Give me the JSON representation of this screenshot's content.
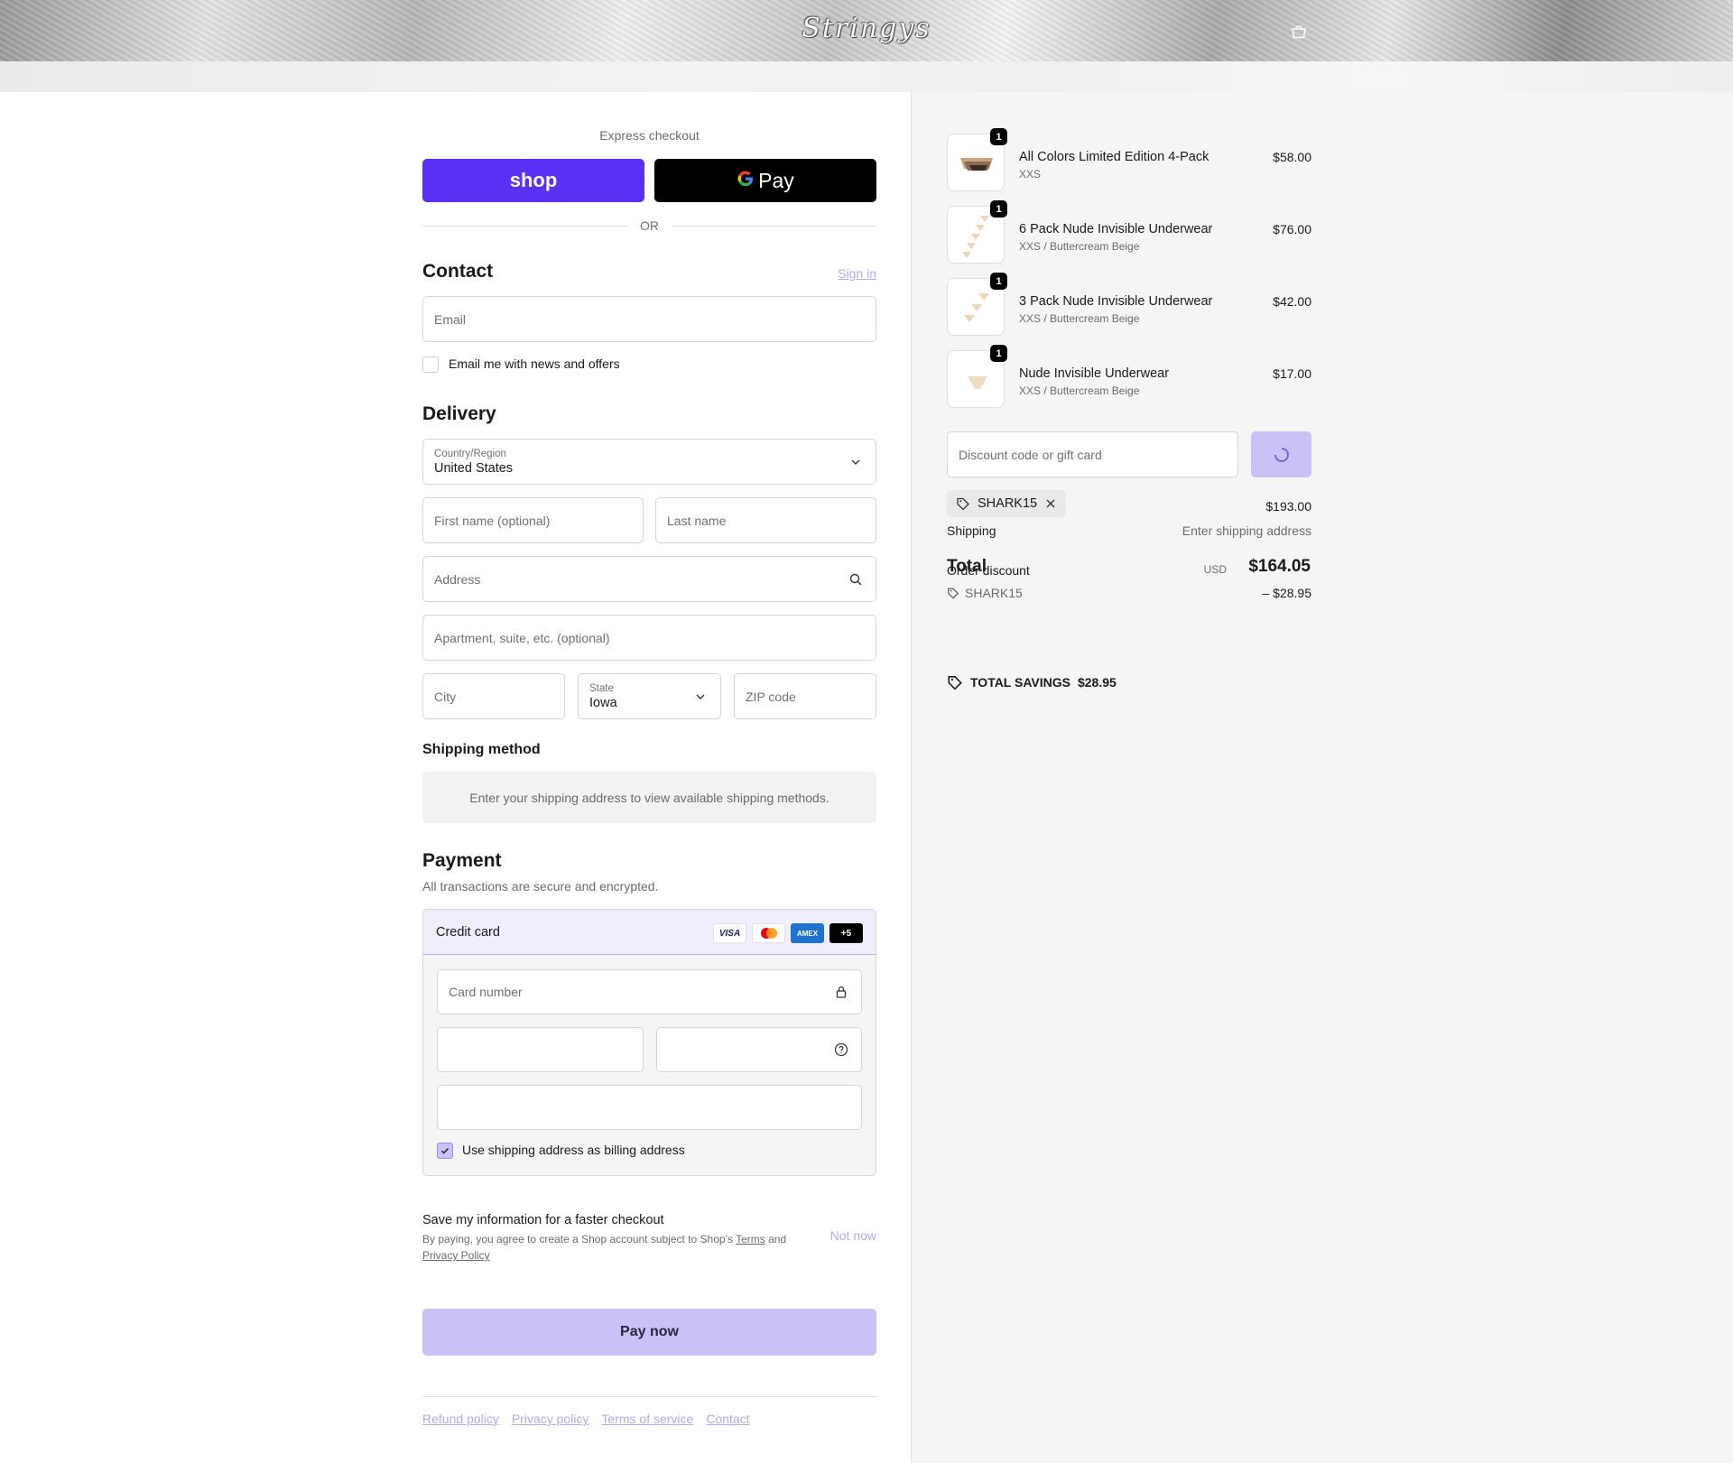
{
  "header": {
    "store_name": "Stringys",
    "cart_icon": "bag-icon"
  },
  "express": {
    "title": "Express checkout",
    "shop_label": "shop",
    "gpay_label": "Pay",
    "or_label": "OR"
  },
  "contact": {
    "title": "Contact",
    "sign_in": "Sign in",
    "email_placeholder": "Email",
    "newsletter_label": "Email me with news and offers",
    "newsletter_checked": false
  },
  "delivery": {
    "title": "Delivery",
    "country_label": "Country/Region",
    "country_value": "United States",
    "first_name_placeholder": "First name (optional)",
    "last_name_placeholder": "Last name",
    "address_placeholder": "Address",
    "apartment_placeholder": "Apartment, suite, etc. (optional)",
    "city_placeholder": "City",
    "state_label": "State",
    "state_value": "Iowa",
    "zip_placeholder": "ZIP code"
  },
  "shipping_method": {
    "title": "Shipping method",
    "message": "Enter your shipping address to view available shipping methods."
  },
  "payment": {
    "title": "Payment",
    "subtitle": "All transactions are secure and encrypted.",
    "method_label": "Credit card",
    "brands": [
      "VISA",
      "Mastercard",
      "AMEX",
      "+5"
    ],
    "card_number_placeholder": "Card number",
    "billing_same_label": "Use shipping address as billing address",
    "billing_same_checked": true
  },
  "save_info": {
    "title": "Save my information for a faster checkout",
    "text_before": "By paying, you agree to create a Shop account subject to Shop’s ",
    "terms": "Terms",
    "and": " and",
    "privacy": "Privacy Policy",
    "not_now": "Not now"
  },
  "pay_now": "Pay now",
  "footer": {
    "links": [
      "Refund policy",
      "Privacy policy",
      "Terms of service",
      "Contact"
    ]
  },
  "cart": {
    "items": [
      {
        "name": "All Colors Limited Edition 4-Pack",
        "variant": "XXS",
        "price": "$58.00",
        "qty": "1"
      },
      {
        "name": "6 Pack Nude Invisible Underwear",
        "variant": "XXS / Buttercream Beige",
        "price": "$76.00",
        "qty": "1"
      },
      {
        "name": "3 Pack Nude Invisible Underwear",
        "variant": "XXS / Buttercream Beige",
        "price": "$42.00",
        "qty": "1"
      },
      {
        "name": "Nude Invisible Underwear",
        "variant": "XXS / Buttercream Beige",
        "price": "$17.00",
        "qty": "1"
      }
    ],
    "discount_placeholder": "Discount code or gift card",
    "applied_code": "SHARK15",
    "subtotal_value": "$193.00",
    "shipping_label": "Shipping",
    "shipping_value": "Enter shipping address",
    "order_discount_label": "Order discount",
    "discount_code": "SHARK15",
    "discount_value": "– $28.95",
    "total_label": "Total",
    "currency": "USD",
    "total_value": "$164.05",
    "savings_label": "TOTAL SAVINGS",
    "savings_value": "$28.95"
  },
  "colors": {
    "accent": "#5a31f4",
    "accent_light": "#c8c2f7",
    "link": "#b5a9ef"
  }
}
